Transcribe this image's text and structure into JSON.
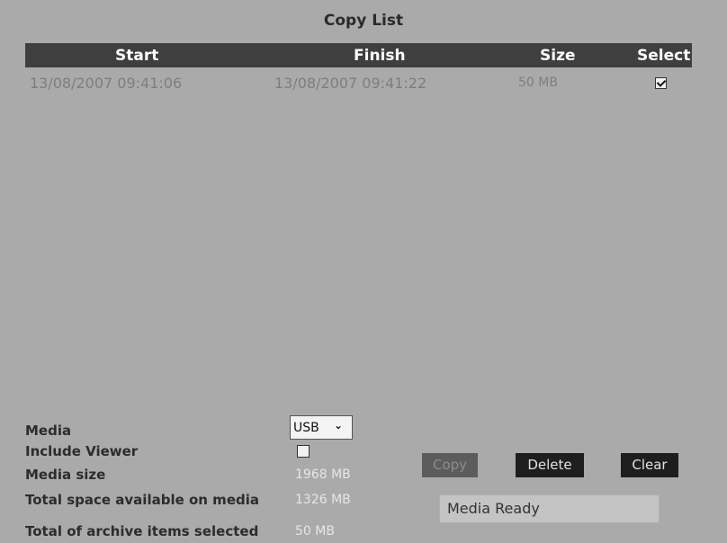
{
  "title": "Copy List",
  "table": {
    "columns": [
      "Start",
      "Finish",
      "Size",
      "Select"
    ],
    "rows": [
      {
        "start": "13/08/2007 09:41:06",
        "finish": "13/08/2007 09:41:22",
        "size": "50 MB",
        "selected": true
      }
    ]
  },
  "form": {
    "media_label": "Media",
    "media_value": "USB",
    "include_viewer_label": "Include Viewer",
    "include_viewer_checked": false,
    "media_size_label": "Media size",
    "media_size_value": "1968 MB",
    "space_available_label": "Total space available on media",
    "space_available_value": "1326 MB",
    "total_selected_label": "Total of archive items selected",
    "total_selected_value": "50 MB"
  },
  "buttons": {
    "copy": "Copy",
    "delete": "Delete",
    "clear": "Clear"
  },
  "status_text": "Media Ready"
}
